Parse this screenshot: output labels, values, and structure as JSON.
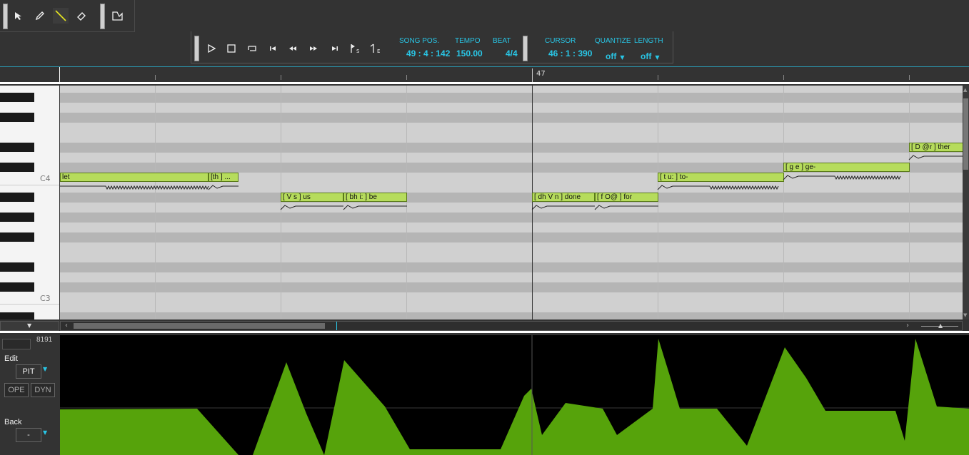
{
  "transport": {
    "song_pos_label": "SONG POS.",
    "song_pos_value": "49 : 4 : 142",
    "tempo_label": "TEMPO",
    "tempo_value": "150.00",
    "beat_label": "BEAT",
    "beat_value": "4/4",
    "cursor_label": "CURSOR",
    "cursor_value": "46 : 1 : 390",
    "quantize_label": "QUANTIZE",
    "quantize_value": "off",
    "length_label": "LENGTH",
    "length_value": "off"
  },
  "ruler": {
    "measure": "47"
  },
  "keyboard": {
    "c4": "C4",
    "c3": "C3"
  },
  "notes": [
    {
      "text": "let"
    },
    {
      "text": "[th ] ..."
    },
    {
      "text": "[ V s ] us"
    },
    {
      "text": "[ bh i: ] be"
    },
    {
      "text": "[ dh V n ] done"
    },
    {
      "text": "[ f O@ ] for"
    },
    {
      "text": "[ t u: ] to-"
    },
    {
      "text": "[ g e ] ge-"
    },
    {
      "text": "[ D @r ] ther"
    }
  ],
  "control_panel": {
    "max_value": "8191",
    "edit_label": "Edit",
    "edit_param": "PIT",
    "ope_label": "OPE",
    "dyn_label": "DYN",
    "back_label": "Back",
    "back_value": "-"
  },
  "colors": {
    "accent": "#29c6e6",
    "note_fill": "#b6dc5c",
    "curve": "#5aaa0a"
  }
}
